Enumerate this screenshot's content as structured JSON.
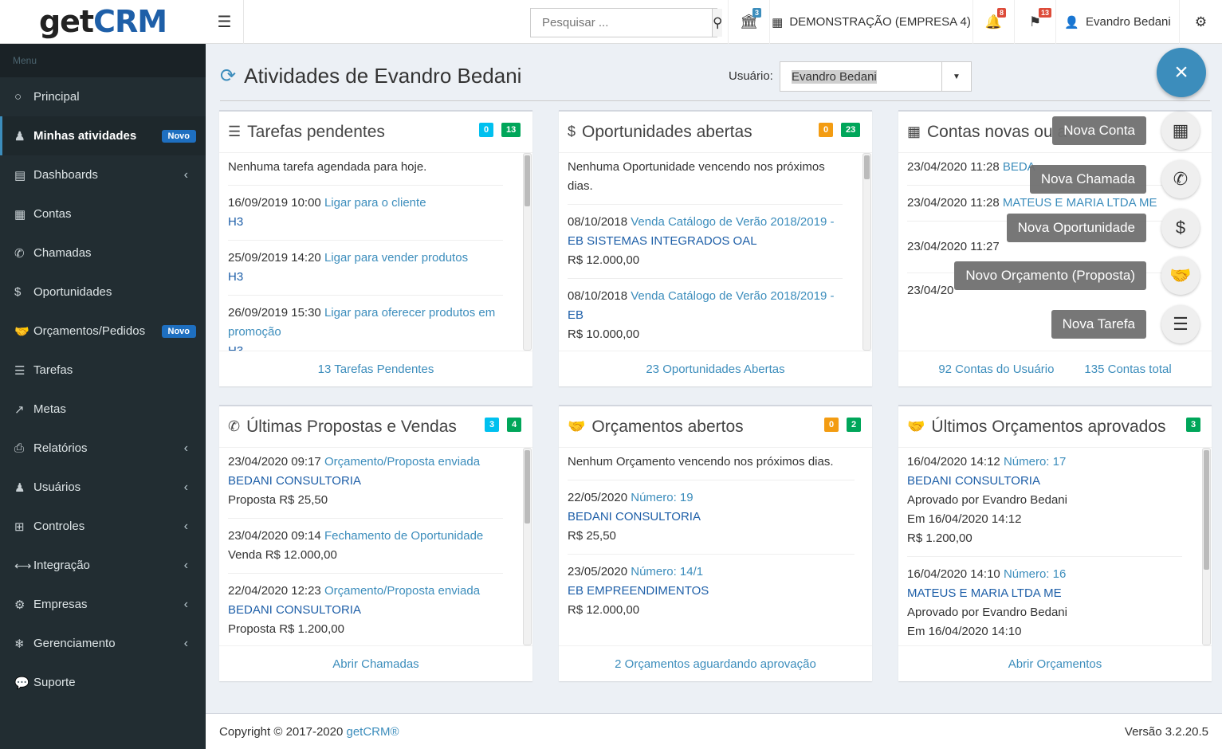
{
  "brand": {
    "p1": "get",
    "p2": "CRM"
  },
  "header": {
    "search_placeholder": "Pesquisar ...",
    "bank_badge": "3",
    "company": "DEMONSTRAÇÃO (EMPRESA 4)",
    "bell_badge": "8",
    "flag_badge": "13",
    "user": "Evandro Bedani"
  },
  "sidebar": {
    "menu_label": "Menu",
    "items": [
      {
        "label": "Principal",
        "badge": ""
      },
      {
        "label": "Minhas atividades",
        "badge": "Novo"
      },
      {
        "label": "Dashboards",
        "badge": ""
      },
      {
        "label": "Contas",
        "badge": ""
      },
      {
        "label": "Chamadas",
        "badge": ""
      },
      {
        "label": "Oportunidades",
        "badge": ""
      },
      {
        "label": "Orçamentos/Pedidos",
        "badge": "Novo"
      },
      {
        "label": "Tarefas",
        "badge": ""
      },
      {
        "label": "Metas",
        "badge": ""
      },
      {
        "label": "Relatórios",
        "badge": ""
      },
      {
        "label": "Usuários",
        "badge": ""
      },
      {
        "label": "Controles",
        "badge": ""
      },
      {
        "label": "Integração",
        "badge": ""
      },
      {
        "label": "Empresas",
        "badge": ""
      },
      {
        "label": "Gerenciamento",
        "badge": ""
      },
      {
        "label": "Suporte",
        "badge": ""
      }
    ]
  },
  "page": {
    "title": "Atividades de Evandro Bedani",
    "user_label": "Usuário:",
    "user_value": "Evandro Bedani"
  },
  "boxes": {
    "tarefas": {
      "title": "Tarefas pendentes",
      "b1": "0",
      "b2": "13",
      "empty": "Nenhuma tarefa agendada para hoje.",
      "items": [
        {
          "date": "16/09/2019 10:00",
          "link": "Ligar para o cliente",
          "sub": "H3"
        },
        {
          "date": "25/09/2019 14:20",
          "link": "Ligar para vender produtos",
          "sub": "H3"
        },
        {
          "date": "26/09/2019 15:30",
          "link": "Ligar para oferecer produtos em promoção",
          "sub": "H3"
        }
      ],
      "footer": "13 Tarefas Pendentes"
    },
    "oport": {
      "title": "Oportunidades abertas",
      "b1": "0",
      "b2": "23",
      "empty": "Nenhuma Oportunidade vencendo nos próximos dias.",
      "items": [
        {
          "date": "08/10/2018",
          "link": "Venda Catálogo de Verão 2018/2019 -",
          "company": "EB SISTEMAS INTEGRADOS OAL",
          "value": "R$ 12.000,00"
        },
        {
          "date": "08/10/2018",
          "link": "Venda Catálogo de Verão 2018/2019 -",
          "company": "EB",
          "value": "R$ 10.000,00"
        }
      ],
      "footer": "23 Oportunidades Abertas"
    },
    "contas": {
      "title": "Contas novas ou a",
      "items": [
        {
          "date": "23/04/2020 11:28",
          "link": "BEDA"
        },
        {
          "date": "23/04/2020 11:28",
          "link": "MATEUS E MARIA LTDA ME"
        },
        {
          "date": "23/04/2020 11:27",
          "link": ""
        },
        {
          "date": "23/04/20",
          "link": ""
        }
      ],
      "f1": "92 Contas do Usuário",
      "f2": "135 Contas total"
    },
    "propostas": {
      "title": "Últimas Propostas e Vendas",
      "b1": "3",
      "b2": "4",
      "items": [
        {
          "date": "23/04/2020 09:17",
          "link": "Orçamento/Proposta enviada",
          "company": "BEDANI CONSULTORIA",
          "value": "Proposta R$ 25,50"
        },
        {
          "date": "23/04/2020 09:14",
          "link": "Fechamento de Oportunidade",
          "company": "",
          "value": "Venda R$ 12.000,00"
        },
        {
          "date": "22/04/2020 12:23",
          "link": "Orçamento/Proposta enviada",
          "company": "BEDANI CONSULTORIA",
          "value": "Proposta R$ 1.200,00"
        }
      ],
      "footer": "Abrir Chamadas"
    },
    "orcamentos": {
      "title": "Orçamentos abertos",
      "b1": "0",
      "b2": "2",
      "empty": "Nenhum Orçamento vencendo nos próximos dias.",
      "items": [
        {
          "date": "22/05/2020",
          "link": "Número: 19",
          "company": "BEDANI CONSULTORIA",
          "value": "R$ 25,50"
        },
        {
          "date": "23/05/2020",
          "link": "Número: 14/1",
          "company": "EB EMPREENDIMENTOS",
          "value": "R$ 12.000,00"
        }
      ],
      "footer": "2 Orçamentos aguardando aprovação"
    },
    "aprovados": {
      "title": "Últimos Orçamentos aprovados",
      "b1": "3",
      "items": [
        {
          "date": "16/04/2020 14:12",
          "link": "Número: 17",
          "company": "BEDANI CONSULTORIA",
          "by": "Aprovado por Evandro Bedani",
          "when": "Em 16/04/2020 14:12",
          "value": "R$ 1.200,00"
        },
        {
          "date": "16/04/2020 14:10",
          "link": "Número: 16",
          "company": "MATEUS E MARIA LTDA ME",
          "by": "Aprovado por Evandro Bedani",
          "when": "Em 16/04/2020 14:10",
          "value": ""
        }
      ],
      "footer": "Abrir Orçamentos"
    }
  },
  "fab": {
    "close": "×",
    "items": [
      "Nova Conta",
      "Nova Chamada",
      "Nova Oportunidade",
      "Novo Orçamento (Proposta)",
      "Nova Tarefa"
    ]
  },
  "footer": {
    "copyright": "Copyright © 2017-2020 ",
    "brand": "getCRM®",
    "version": "Versão 3.2.20.5"
  }
}
